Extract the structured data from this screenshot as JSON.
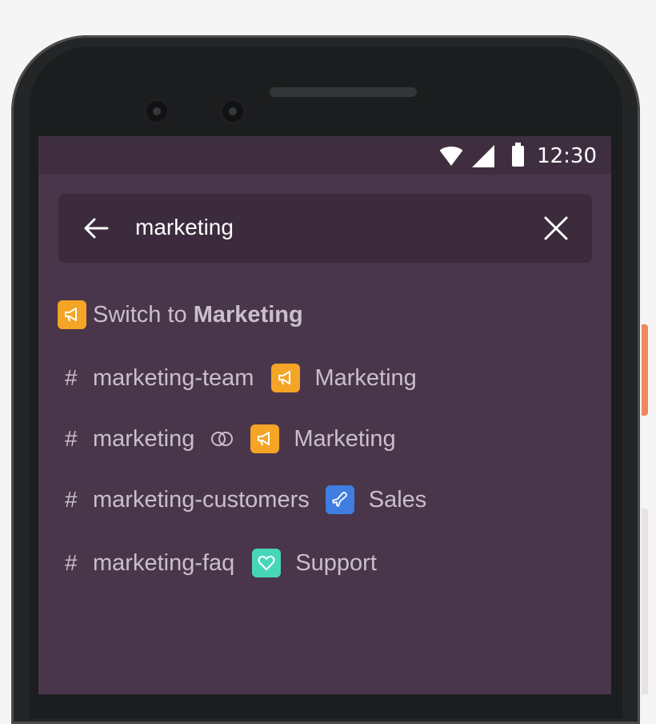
{
  "status_bar": {
    "time": "12:30",
    "icons": [
      "wifi-icon",
      "signal-icon",
      "battery-icon"
    ]
  },
  "search": {
    "query": "marketing",
    "back_icon": "arrow-left-icon",
    "clear_icon": "close-icon"
  },
  "switch_workspace": {
    "prefix": "Switch to",
    "workspace": "Marketing",
    "icon": "megaphone-icon"
  },
  "results": [
    {
      "channel": "marketing-team",
      "shared": false,
      "workspace": "Marketing",
      "workspace_icon": "megaphone-icon",
      "badge_color": "#f4a526"
    },
    {
      "channel": "marketing",
      "shared": true,
      "workspace": "Marketing",
      "workspace_icon": "megaphone-icon",
      "badge_color": "#f4a526"
    },
    {
      "channel": "marketing-customers",
      "shared": false,
      "workspace": "Sales",
      "workspace_icon": "airplane-icon",
      "badge_color": "#3f7ee0"
    },
    {
      "channel": "marketing-faq",
      "shared": false,
      "workspace": "Support",
      "workspace_icon": "heart-icon",
      "badge_color": "#48d6b8"
    }
  ],
  "colors": {
    "background": "#4a364b",
    "status_bar": "#3f2e40",
    "search_bar": "#3b2b3c",
    "text": "#c9bfca"
  }
}
